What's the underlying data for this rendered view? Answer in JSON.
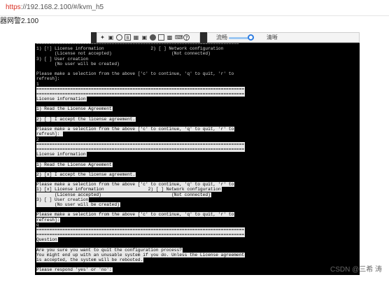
{
  "browser": {
    "url_scheme": "https",
    "url_rest": "://192.168.2.100/#/kvm_h5"
  },
  "page": {
    "title": "器网警2.100"
  },
  "toolbar": {
    "icons": [
      "pin-icon",
      "fit-icon",
      "target-icon",
      "b-icon",
      "grid-icon",
      "lock-icon",
      "record-icon",
      "fullscreen-icon",
      "camera-icon",
      "keyboard-icon",
      "help-icon"
    ],
    "quality_left_label": "流畅",
    "quality_right_label": "清晰",
    "quality_level": 0.85
  },
  "terminal": {
    "lines": [
      {
        "text": "==============================================================================",
        "hl": false
      },
      {
        "text": "1) [!] License information                  2) [ ] Network configuration",
        "hl": false
      },
      {
        "text": "       (License not accepted)                       (Not connected)",
        "hl": false
      },
      {
        "text": "3) [ ] User creation",
        "hl": false
      },
      {
        "text": "       (No user will be created)",
        "hl": false
      },
      {
        "text": "",
        "hl": false
      },
      {
        "text": "Please make a selection from the above ['c' to continue, 'q' to quit, 'r' to",
        "hl": false
      },
      {
        "text": "refresh]:",
        "hl": false
      },
      {
        "text": "1",
        "hl": false
      },
      {
        "text": "================================================================================",
        "hl": true
      },
      {
        "text": "================================================================================",
        "hl": true
      },
      {
        "text": "License information",
        "hl": true
      },
      {
        "text": "",
        "hl": false
      },
      {
        "text": "1) Read the License Agreement",
        "hl": true
      },
      {
        "text": "",
        "hl": false
      },
      {
        "text": "2) [ ] I accept the license agreement.",
        "hl": true
      },
      {
        "text": "",
        "hl": false
      },
      {
        "text": "Please make a selection from the above ['c' to continue, 'q' to quit, 'r' to",
        "hl": true
      },
      {
        "text": "refresh]: ",
        "hl": true
      },
      {
        "text": "2",
        "hl": false
      },
      {
        "text": "================================================================================",
        "hl": true
      },
      {
        "text": "================================================================================",
        "hl": true
      },
      {
        "text": "License information",
        "hl": true
      },
      {
        "text": "",
        "hl": false
      },
      {
        "text": "1) Read the License Agreement",
        "hl": true
      },
      {
        "text": "",
        "hl": false
      },
      {
        "text": "2) [x] I accept the license agreement.",
        "hl": true
      },
      {
        "text": "",
        "hl": false
      },
      {
        "text": "Please make a selection from the above ['c' to continue, 'q' to quit, 'r' to",
        "hl": true
      },
      {
        "text": "1) [x] License information                 2) [ ] Network configuration",
        "hl": true
      },
      {
        "text": "       (License accepted)                           (Not connected)",
        "hl": true
      },
      {
        "text": "3) [ ] User creation",
        "hl": true
      },
      {
        "text": "       (No user will be created)",
        "hl": true
      },
      {
        "text": "",
        "hl": false
      },
      {
        "text": "Please make a selection from the above ['c' to continue, 'q' to quit, 'r' to",
        "hl": true
      },
      {
        "text": "refresh]:",
        "hl": true
      },
      {
        "text": "q",
        "hl": false
      },
      {
        "text": "================================================================================",
        "hl": true
      },
      {
        "text": "================================================================================",
        "hl": true
      },
      {
        "text": "Question",
        "hl": true
      },
      {
        "text": "",
        "hl": false
      },
      {
        "text": "Are you sure you want to quit the configuration process?",
        "hl": true
      },
      {
        "text": "You might end up with an unusable system if you do. Unless the License agreement",
        "hl": true
      },
      {
        "text": "is accepted, the system will be rebooted.",
        "hl": true
      },
      {
        "text": "",
        "hl": false
      },
      {
        "text": "Please respond 'yes' or 'no':",
        "hl": true
      }
    ]
  },
  "watermark": {
    "text": "CSDN @三希 涛"
  }
}
